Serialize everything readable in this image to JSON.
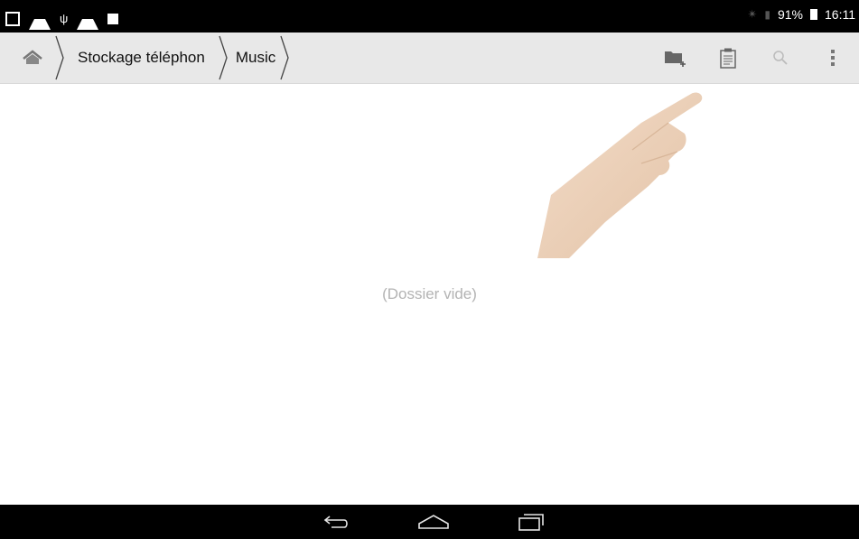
{
  "status_bar": {
    "battery": "91%",
    "time": "16:11",
    "bluetooth": "bluetooth-icon",
    "signal": "signal-icon"
  },
  "breadcrumb": {
    "items": [
      "Stockage téléphon",
      "Music"
    ]
  },
  "actions": [
    "new-folder-icon",
    "paste-icon",
    "search-icon",
    "overflow-menu-icon"
  ],
  "content": {
    "empty_message": "(Dossier vide)"
  },
  "nav": [
    "back-icon",
    "home-icon",
    "recent-apps-icon"
  ]
}
